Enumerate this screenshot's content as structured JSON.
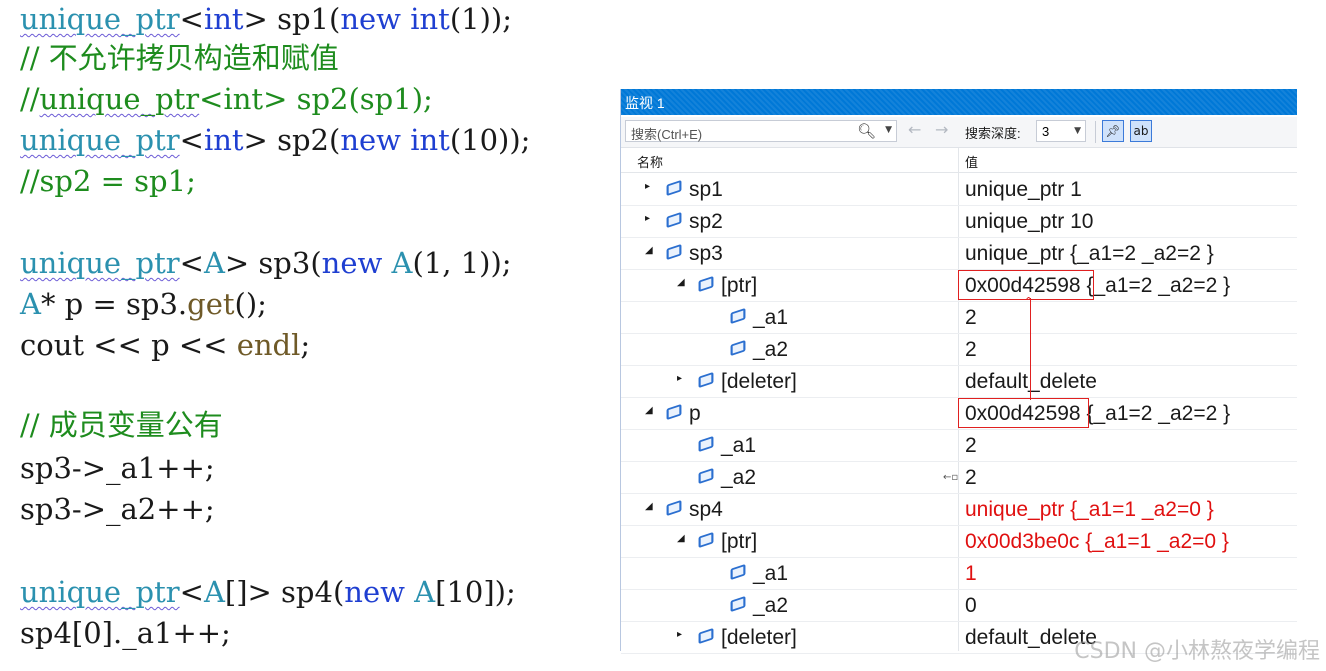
{
  "code": {
    "lines": [
      {
        "tokens": [
          {
            "t": "unique_ptr",
            "c": "type",
            "sq": true
          },
          {
            "t": "<",
            "c": "pl"
          },
          {
            "t": "int",
            "c": "kw"
          },
          {
            "t": "> ",
            "c": "pl"
          },
          {
            "t": "sp1",
            "c": "var"
          },
          {
            "t": "(",
            "c": "pl"
          },
          {
            "t": "new",
            "c": "kw"
          },
          {
            "t": " ",
            "c": "pl"
          },
          {
            "t": "int",
            "c": "kw"
          },
          {
            "t": "(1));",
            "c": "pl"
          }
        ]
      },
      {
        "tokens": [
          {
            "t": "// 不允许拷贝构造和赋值",
            "c": "cm"
          }
        ]
      },
      {
        "tokens": [
          {
            "t": "//",
            "c": "cm"
          },
          {
            "t": "unique_ptr",
            "c": "cm",
            "sq": true
          },
          {
            "t": "<int> sp2(sp1);",
            "c": "cm"
          }
        ]
      },
      {
        "tokens": [
          {
            "t": "unique_ptr",
            "c": "type",
            "sq": true
          },
          {
            "t": "<",
            "c": "pl"
          },
          {
            "t": "int",
            "c": "kw"
          },
          {
            "t": "> ",
            "c": "pl"
          },
          {
            "t": "sp2",
            "c": "var"
          },
          {
            "t": "(",
            "c": "pl"
          },
          {
            "t": "new",
            "c": "kw"
          },
          {
            "t": " ",
            "c": "pl"
          },
          {
            "t": "int",
            "c": "kw"
          },
          {
            "t": "(10));",
            "c": "pl"
          }
        ]
      },
      {
        "tokens": [
          {
            "t": "//sp2 = sp1;",
            "c": "cm"
          }
        ]
      },
      {
        "tokens": []
      },
      {
        "tokens": [
          {
            "t": "unique_ptr",
            "c": "type",
            "sq": true
          },
          {
            "t": "<",
            "c": "pl"
          },
          {
            "t": "A",
            "c": "type"
          },
          {
            "t": "> ",
            "c": "pl"
          },
          {
            "t": "sp3",
            "c": "var"
          },
          {
            "t": "(",
            "c": "pl"
          },
          {
            "t": "new",
            "c": "kw"
          },
          {
            "t": " ",
            "c": "pl"
          },
          {
            "t": "A",
            "c": "type"
          },
          {
            "t": "(1, 1));",
            "c": "pl"
          }
        ]
      },
      {
        "tokens": [
          {
            "t": "A",
            "c": "type"
          },
          {
            "t": "* ",
            "c": "pl"
          },
          {
            "t": "p",
            "c": "var"
          },
          {
            "t": " = ",
            "c": "pl"
          },
          {
            "t": "sp3",
            "c": "var"
          },
          {
            "t": ".",
            "c": "pl"
          },
          {
            "t": "get",
            "c": "fn"
          },
          {
            "t": "();",
            "c": "pl"
          }
        ]
      },
      {
        "tokens": [
          {
            "t": "cout",
            "c": "var"
          },
          {
            "t": " << ",
            "c": "pl"
          },
          {
            "t": "p",
            "c": "var"
          },
          {
            "t": " << ",
            "c": "pl"
          },
          {
            "t": "endl",
            "c": "fn"
          },
          {
            "t": ";",
            "c": "pl"
          }
        ]
      },
      {
        "tokens": []
      },
      {
        "tokens": [
          {
            "t": "// 成员变量公有",
            "c": "cm"
          }
        ]
      },
      {
        "tokens": [
          {
            "t": "sp3",
            "c": "var"
          },
          {
            "t": "->",
            "c": "pl"
          },
          {
            "t": "_a1",
            "c": "var"
          },
          {
            "t": "++;",
            "c": "pl"
          }
        ]
      },
      {
        "tokens": [
          {
            "t": "sp3",
            "c": "var"
          },
          {
            "t": "->",
            "c": "pl"
          },
          {
            "t": "_a2",
            "c": "var"
          },
          {
            "t": "++;",
            "c": "pl"
          }
        ]
      },
      {
        "tokens": []
      },
      {
        "tokens": [
          {
            "t": "unique_ptr",
            "c": "type",
            "sq": true
          },
          {
            "t": "<",
            "c": "pl"
          },
          {
            "t": "A",
            "c": "type"
          },
          {
            "t": "[]> ",
            "c": "pl"
          },
          {
            "t": "sp4",
            "c": "var"
          },
          {
            "t": "(",
            "c": "pl"
          },
          {
            "t": "new",
            "c": "kw"
          },
          {
            "t": " ",
            "c": "pl"
          },
          {
            "t": "A",
            "c": "type"
          },
          {
            "t": "[10]);",
            "c": "pl"
          }
        ]
      },
      {
        "tokens": [
          {
            "t": "sp4",
            "c": "var"
          },
          {
            "t": "[0].",
            "c": "pl"
          },
          {
            "t": "_a1",
            "c": "var"
          },
          {
            "t": "++;",
            "c": "pl"
          }
        ]
      }
    ]
  },
  "watch": {
    "title": "监视 1",
    "search_placeholder": "搜索(Ctrl+E)",
    "search_icon": "search-icon",
    "depth_label": "搜索深度:",
    "depth_value": "3",
    "col_name": "名称",
    "col_value": "值",
    "rows": [
      {
        "name": "sp1",
        "value": "unique_ptr 1",
        "level": 0,
        "expander": "collapsed",
        "changed": false
      },
      {
        "name": "sp2",
        "value": "unique_ptr 10",
        "level": 0,
        "expander": "collapsed",
        "changed": false
      },
      {
        "name": "sp3",
        "value": "unique_ptr {_a1=2 _a2=2 }",
        "level": 0,
        "expander": "expanded",
        "changed": false
      },
      {
        "name": "[ptr]",
        "value": "0x00d42598 {_a1=2 _a2=2 }",
        "level": 1,
        "expander": "expanded",
        "changed": false
      },
      {
        "name": "_a1",
        "value": "2",
        "level": 2,
        "expander": "none",
        "changed": false
      },
      {
        "name": "_a2",
        "value": "2",
        "level": 2,
        "expander": "none",
        "changed": false
      },
      {
        "name": "[deleter]",
        "value": "default_delete",
        "level": 1,
        "expander": "collapsed",
        "changed": false
      },
      {
        "name": "p",
        "value": "0x00d42598 {_a1=2 _a2=2 }",
        "level": 0,
        "expander": "expanded",
        "changed": false
      },
      {
        "name": "_a1",
        "value": "2",
        "level": 1,
        "expander": "none",
        "changed": false
      },
      {
        "name": "_a2",
        "value": "2",
        "level": 1,
        "expander": "none",
        "changed": false,
        "pin": true
      },
      {
        "name": "sp4",
        "value": "unique_ptr {_a1=1 _a2=0 }",
        "level": 0,
        "expander": "expanded",
        "changed": true
      },
      {
        "name": "[ptr]",
        "value": "0x00d3be0c {_a1=1 _a2=0 }",
        "level": 1,
        "expander": "expanded",
        "changed": true
      },
      {
        "name": "_a1",
        "value": "1",
        "level": 2,
        "expander": "none",
        "changed": true
      },
      {
        "name": "_a2",
        "value": "0",
        "level": 2,
        "expander": "none",
        "changed": false
      },
      {
        "name": "[deleter]",
        "value": "default_delete",
        "level": 1,
        "expander": "collapsed",
        "changed": false
      }
    ]
  },
  "watermark": "CSDN @小林熬夜学编程",
  "colors": {
    "accent": "#0078d7",
    "changed": "#e01010",
    "highlight": "#e02020"
  }
}
